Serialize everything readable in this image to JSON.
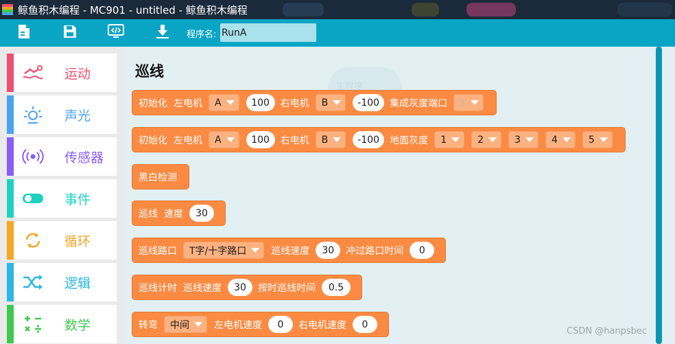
{
  "window": {
    "title": "鲸鱼积木编程 - MC901 - untitled  - 鲸鱼积木编程"
  },
  "toolbar": {
    "buttons": [
      {
        "icon": "new-file-icon"
      },
      {
        "icon": "save-icon"
      },
      {
        "icon": "code-view-icon"
      },
      {
        "icon": "download-icon"
      }
    ],
    "program_label": "程序名:",
    "program_name": "RunA"
  },
  "sidebar": {
    "items": [
      {
        "label": "运动",
        "icon": "swimmer-icon",
        "color": "#f0506e"
      },
      {
        "label": "声光",
        "icon": "light-icon",
        "color": "#4aa3f0"
      },
      {
        "label": "传感器",
        "icon": "sensor-icon",
        "color": "#8a5cf5"
      },
      {
        "label": "事件",
        "icon": "toggle-icon",
        "color": "#1fd1c0"
      },
      {
        "label": "循环",
        "icon": "loop-icon",
        "color": "#f5a623"
      },
      {
        "label": "逻辑",
        "icon": "shuffle-icon",
        "color": "#2ab6e8"
      },
      {
        "label": "数学",
        "icon": "math-icon",
        "color": "#3fc94f"
      }
    ]
  },
  "workspace": {
    "title": "巡线",
    "ghost_label": "主程序",
    "blocks": [
      {
        "name": "init-gray-port-block",
        "parts": [
          {
            "t": "text",
            "v": "初始化"
          },
          {
            "t": "text",
            "v": "左电机"
          },
          {
            "t": "dd",
            "v": "A"
          },
          {
            "t": "num",
            "v": "100"
          },
          {
            "t": "text",
            "v": "右电机"
          },
          {
            "t": "dd",
            "v": "B"
          },
          {
            "t": "num",
            "v": "-100"
          },
          {
            "t": "text",
            "v": "集成灰度端口"
          },
          {
            "t": "dd",
            "v": "1",
            "disabled": true
          }
        ]
      },
      {
        "name": "init-ground-gray-block",
        "parts": [
          {
            "t": "text",
            "v": "初始化"
          },
          {
            "t": "text",
            "v": "左电机"
          },
          {
            "t": "dd",
            "v": "A"
          },
          {
            "t": "num",
            "v": "100"
          },
          {
            "t": "text",
            "v": "右电机"
          },
          {
            "t": "dd",
            "v": "B"
          },
          {
            "t": "num",
            "v": "-100"
          },
          {
            "t": "text",
            "v": "地面灰度"
          },
          {
            "t": "dd",
            "v": "1"
          },
          {
            "t": "dd",
            "v": "2"
          },
          {
            "t": "dd",
            "v": "3"
          },
          {
            "t": "dd",
            "v": "4"
          },
          {
            "t": "dd",
            "v": "5"
          }
        ]
      },
      {
        "name": "black-white-detect-block",
        "parts": [
          {
            "t": "text",
            "v": "黑白检测"
          }
        ]
      },
      {
        "name": "line-follow-speed-block",
        "parts": [
          {
            "t": "text",
            "v": "巡线"
          },
          {
            "t": "text",
            "v": "速度"
          },
          {
            "t": "num",
            "v": "30"
          }
        ]
      },
      {
        "name": "line-follow-intersection-block",
        "parts": [
          {
            "t": "text",
            "v": "巡线路口"
          },
          {
            "t": "dd",
            "v": "T字/十字路口"
          },
          {
            "t": "text",
            "v": "巡线速度"
          },
          {
            "t": "num",
            "v": "30"
          },
          {
            "t": "text",
            "v": "冲过路口时间"
          },
          {
            "t": "num",
            "v": "0"
          }
        ]
      },
      {
        "name": "line-follow-timer-block",
        "parts": [
          {
            "t": "text",
            "v": "巡线计时"
          },
          {
            "t": "text",
            "v": "巡线速度"
          },
          {
            "t": "num",
            "v": "30"
          },
          {
            "t": "text",
            "v": "按时巡线时间"
          },
          {
            "t": "num",
            "v": "0.5"
          }
        ]
      },
      {
        "name": "turn-block",
        "parts": [
          {
            "t": "text",
            "v": "转弯"
          },
          {
            "t": "dd",
            "v": "中间"
          },
          {
            "t": "text",
            "v": "左电机速度"
          },
          {
            "t": "num",
            "v": "0"
          },
          {
            "t": "text",
            "v": "右电机速度"
          },
          {
            "t": "num",
            "v": "0"
          }
        ]
      }
    ]
  },
  "watermark": "CSDN @hanpsbec"
}
